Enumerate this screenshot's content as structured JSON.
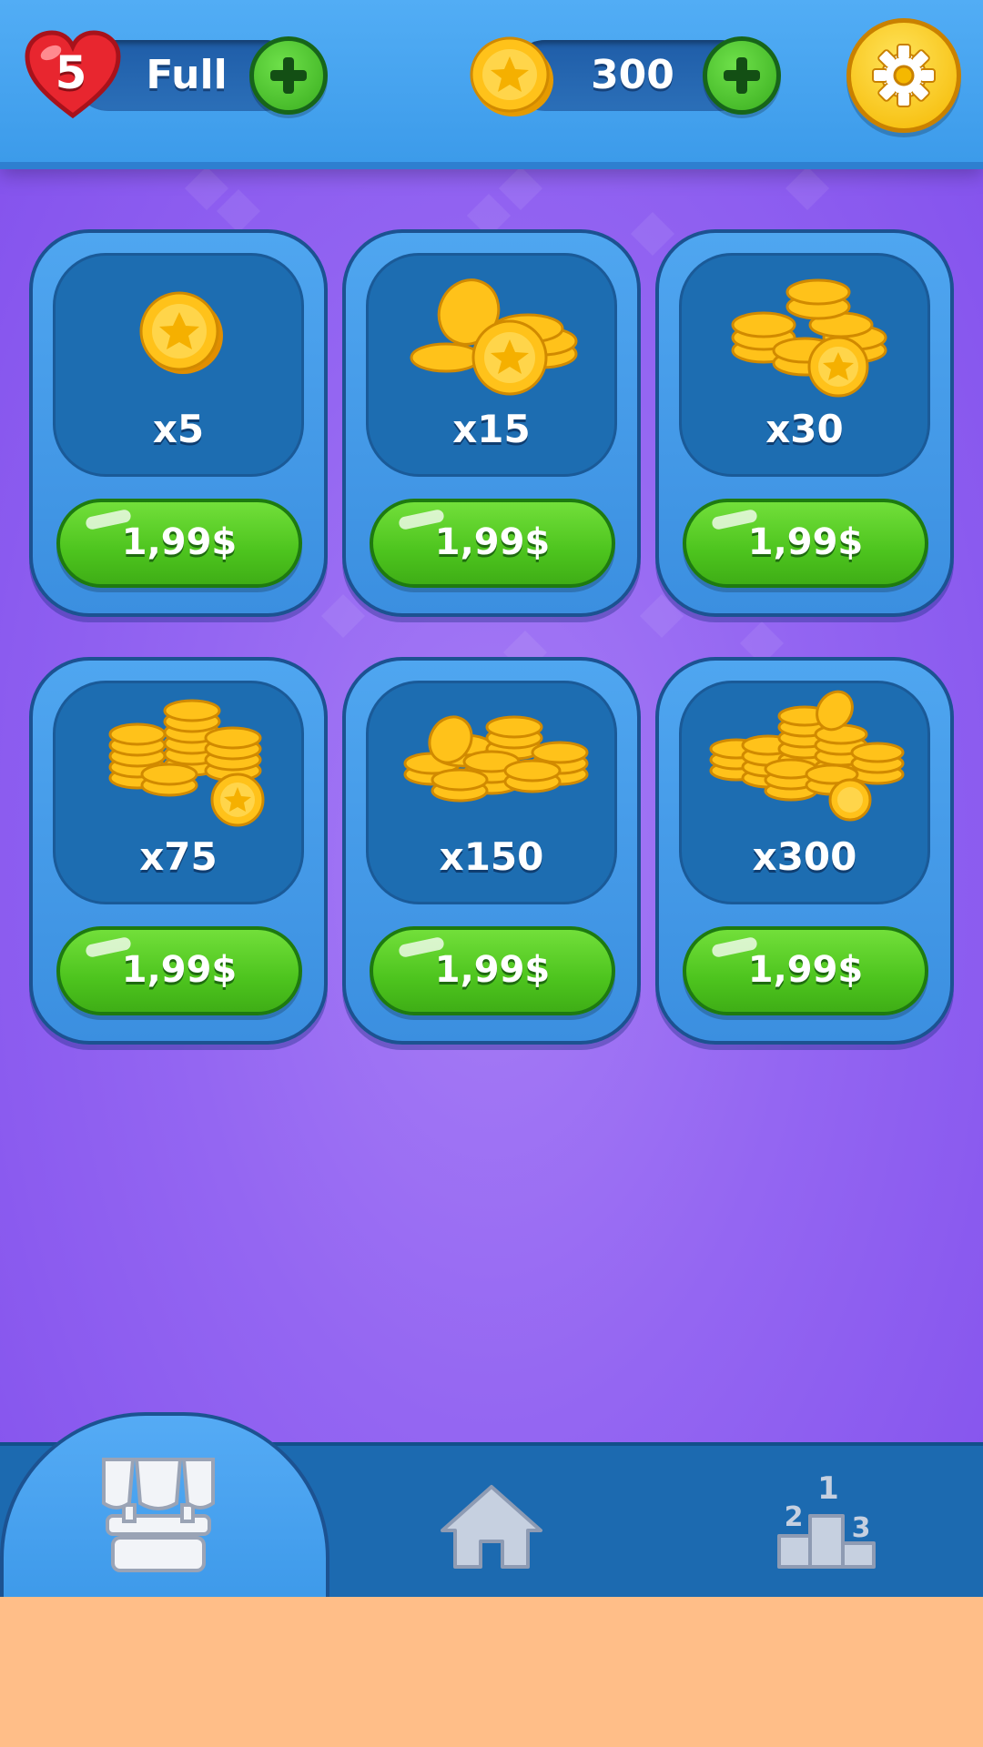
{
  "top_bar": {
    "lives": {
      "count": "5",
      "status": "Full",
      "icon": "heart-icon"
    },
    "coins": {
      "amount": "300",
      "icon": "coin-icon"
    },
    "settings_icon": "gear-icon"
  },
  "shop": {
    "items": [
      {
        "quantity": "x5",
        "price": "1,99$",
        "icon": "coin-stack-icon"
      },
      {
        "quantity": "x15",
        "price": "1,99$",
        "icon": "coin-stack-icon"
      },
      {
        "quantity": "x30",
        "price": "1,99$",
        "icon": "coin-stack-icon"
      },
      {
        "quantity": "x75",
        "price": "1,99$",
        "icon": "coin-stack-icon"
      },
      {
        "quantity": "x150",
        "price": "1,99$",
        "icon": "coin-stack-icon"
      },
      {
        "quantity": "x300",
        "price": "1,99$",
        "icon": "coin-stack-icon"
      }
    ]
  },
  "bottom_nav": {
    "items": [
      {
        "icon": "shop-icon",
        "active": true
      },
      {
        "icon": "home-icon",
        "active": false
      },
      {
        "icon": "leaderboard-icon",
        "active": false
      }
    ],
    "podium_labels": [
      "1",
      "2",
      "3"
    ]
  },
  "colors": {
    "background": "#9466F2",
    "top_bar": "#43A0EE",
    "card": "#3B8FE0",
    "card_inner": "#1D6DB1",
    "buy_button": "#4DC41E",
    "coin": "#F5B800",
    "footer_strip": "#FFBE88"
  }
}
